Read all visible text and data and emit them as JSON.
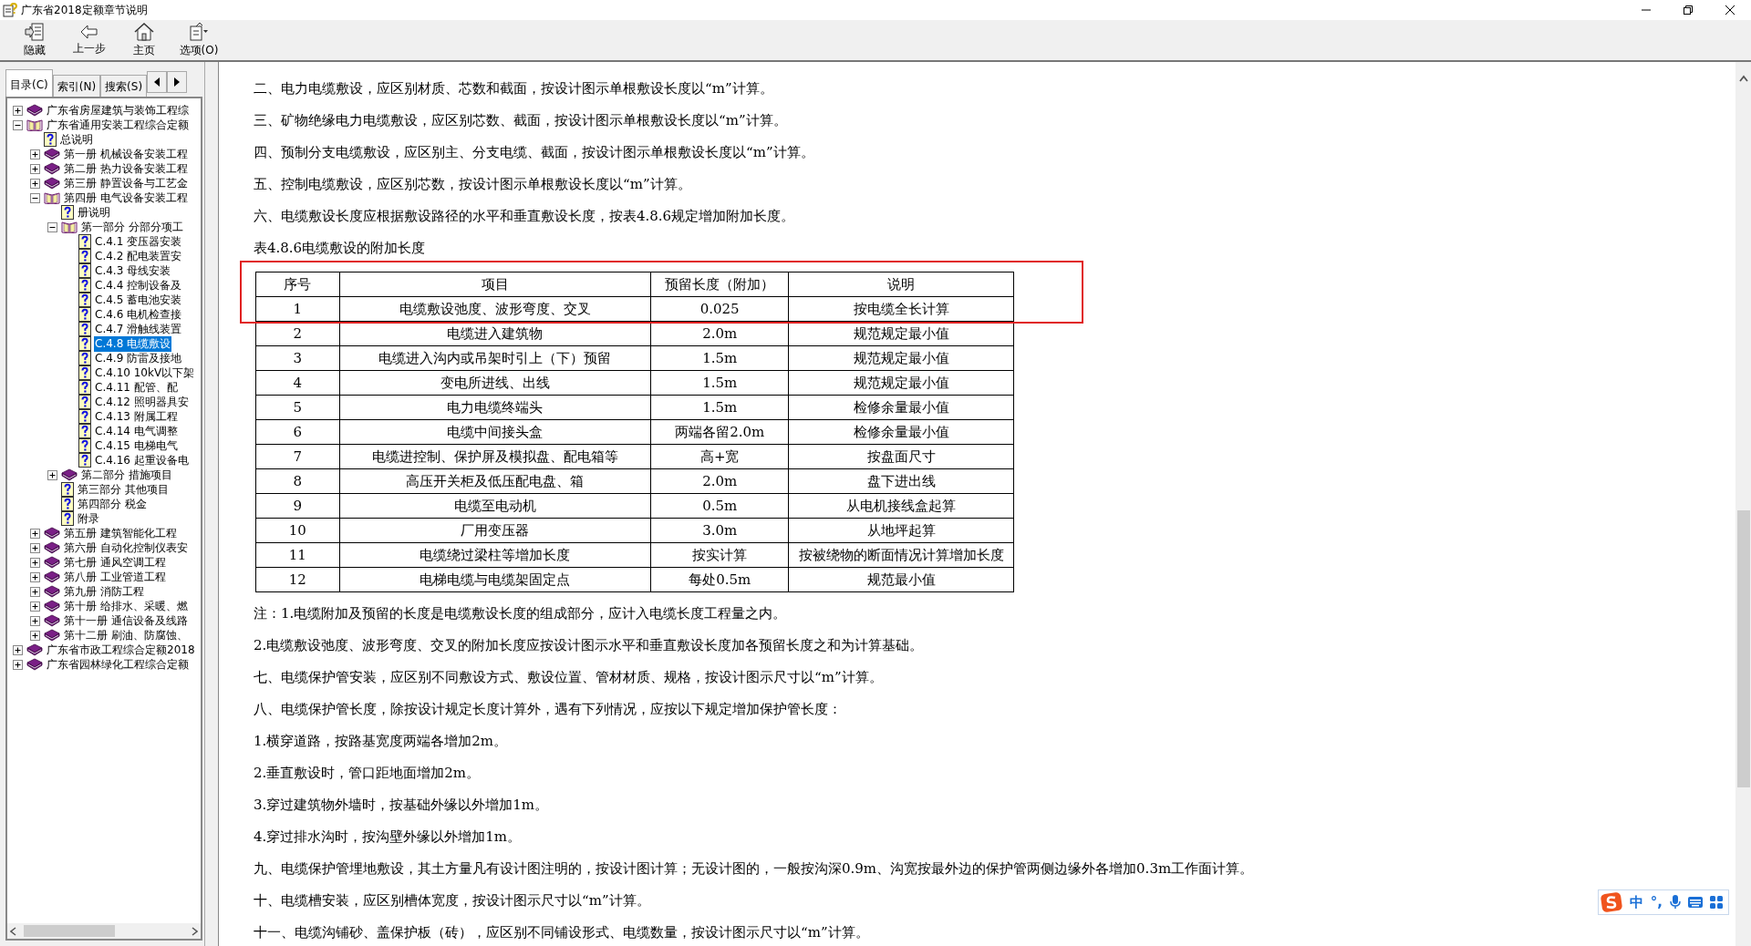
{
  "window": {
    "title": "广东省2018定额章节说明"
  },
  "toolbar": [
    {
      "kind": "hide",
      "label": "隐藏"
    },
    {
      "kind": "back",
      "label": "上一步"
    },
    {
      "kind": "home",
      "label": "主页"
    },
    {
      "kind": "options",
      "label": "选项(O)"
    }
  ],
  "tabs": [
    {
      "label": "目录(C)",
      "selected": true
    },
    {
      "label": "索引(N)",
      "selected": false
    },
    {
      "label": "搜索(S)",
      "selected": false
    }
  ],
  "tree": [
    {
      "label": "广东省房屋建筑与装饰工程综",
      "kind": "book",
      "expanded": false,
      "selected": false
    },
    {
      "label": "广东省通用安装工程综合定额",
      "kind": "book",
      "expanded": true,
      "selected": false,
      "children": [
        {
          "label": "总说明",
          "kind": "page",
          "selected": false
        },
        {
          "label": "第一册 机械设备安装工程",
          "kind": "book",
          "expanded": false,
          "selected": false
        },
        {
          "label": "第二册 热力设备安装工程",
          "kind": "book",
          "expanded": false,
          "selected": false
        },
        {
          "label": "第三册 静置设备与工艺金",
          "kind": "book",
          "expanded": false,
          "selected": false
        },
        {
          "label": "第四册 电气设备安装工程",
          "kind": "book",
          "expanded": true,
          "selected": false,
          "children": [
            {
              "label": "册说明",
              "kind": "page",
              "selected": false
            },
            {
              "label": "第一部分 分部分项工",
              "kind": "book",
              "expanded": true,
              "selected": false,
              "children": [
                {
                  "label": "C.4.1 变压器安装",
                  "kind": "page",
                  "selected": false
                },
                {
                  "label": "C.4.2 配电装置安",
                  "kind": "page",
                  "selected": false
                },
                {
                  "label": "C.4.3 母线安装",
                  "kind": "page",
                  "selected": false
                },
                {
                  "label": "C.4.4 控制设备及",
                  "kind": "page",
                  "selected": false
                },
                {
                  "label": "C.4.5 蓄电池安装",
                  "kind": "page",
                  "selected": false
                },
                {
                  "label": "C.4.6 电机检查接",
                  "kind": "page",
                  "selected": false
                },
                {
                  "label": "C.4.7 滑触线装置",
                  "kind": "page",
                  "selected": false
                },
                {
                  "label": "C.4.8 电缆敷设",
                  "kind": "page",
                  "selected": true
                },
                {
                  "label": "C.4.9 防雷及接地",
                  "kind": "page",
                  "selected": false
                },
                {
                  "label": "C.4.10 10kV以下架",
                  "kind": "page",
                  "selected": false
                },
                {
                  "label": "C.4.11 配管、配",
                  "kind": "page",
                  "selected": false
                },
                {
                  "label": "C.4.12 照明器具安",
                  "kind": "page",
                  "selected": false
                },
                {
                  "label": "C.4.13 附属工程",
                  "kind": "page",
                  "selected": false
                },
                {
                  "label": "C.4.14 电气调整",
                  "kind": "page",
                  "selected": false
                },
                {
                  "label": "C.4.15 电梯电气",
                  "kind": "page",
                  "selected": false
                },
                {
                  "label": "C.4.16 起重设备电",
                  "kind": "page",
                  "selected": false
                }
              ]
            },
            {
              "label": "第二部分 措施项目",
              "kind": "book",
              "expanded": false,
              "selected": false
            },
            {
              "label": "第三部分 其他项目",
              "kind": "page",
              "selected": false
            },
            {
              "label": "第四部分 税金",
              "kind": "page",
              "selected": false
            },
            {
              "label": "附录",
              "kind": "page",
              "selected": false
            }
          ]
        },
        {
          "label": "第五册 建筑智能化工程",
          "kind": "book",
          "expanded": false,
          "selected": false
        },
        {
          "label": "第六册 自动化控制仪表安",
          "kind": "book",
          "expanded": false,
          "selected": false
        },
        {
          "label": "第七册 通风空调工程",
          "kind": "book",
          "expanded": false,
          "selected": false
        },
        {
          "label": "第八册 工业管道工程",
          "kind": "book",
          "expanded": false,
          "selected": false
        },
        {
          "label": "第九册 消防工程",
          "kind": "book",
          "expanded": false,
          "selected": false
        },
        {
          "label": "第十册 给排水、采暖、燃",
          "kind": "book",
          "expanded": false,
          "selected": false
        },
        {
          "label": "第十一册 通信设备及线路",
          "kind": "book",
          "expanded": false,
          "selected": false
        },
        {
          "label": "第十二册 刷油、防腐蚀、",
          "kind": "book",
          "expanded": false,
          "selected": false
        }
      ]
    },
    {
      "label": "广东省市政工程综合定额2018",
      "kind": "book",
      "expanded": false,
      "selected": false
    },
    {
      "label": "广东省园林绿化工程综合定额",
      "kind": "book",
      "expanded": false,
      "selected": false
    }
  ],
  "content_before": [
    "二、电力电缆敷设，应区别材质、芯数和截面，按设计图示单根敷设长度以“m”计算。",
    "三、矿物绝缘电力电缆敷设，应区别芯数、截面，按设计图示单根敷设长度以“m”计算。",
    "四、预制分支电缆敷设，应区别主、分支电缆、截面，按设计图示单根敷设长度以“m”计算。",
    "五、控制电缆敷设，应区别芯数，按设计图示单根敷设长度以“m”计算。",
    "六、电缆敷设长度应根据敷设路径的水平和垂直敷设长度，按表4.8.6规定增加附加长度。",
    "表4.8.6电缆敷设的附加长度"
  ],
  "table": {
    "columns": [
      "序号",
      "项目",
      "预留长度（附加）",
      "说明"
    ],
    "rows": [
      [
        "1",
        "电缆敷设弛度、波形弯度、交叉",
        "0.025",
        "按电缆全长计算"
      ],
      [
        "2",
        "电缆进入建筑物",
        "2.0m",
        "规范规定最小值"
      ],
      [
        "3",
        "电缆进入沟内或吊架时引上（下）预留",
        "1.5m",
        "规范规定最小值"
      ],
      [
        "4",
        "变电所进线、出线",
        "1.5m",
        "规范规定最小值"
      ],
      [
        "5",
        "电力电缆终端头",
        "1.5m",
        "检修余量最小值"
      ],
      [
        "6",
        "电缆中间接头盒",
        "两端各留2.0m",
        "检修余量最小值"
      ],
      [
        "7",
        "电缆进控制、保护屏及模拟盘、配电箱等",
        "高+宽",
        "按盘面尺寸"
      ],
      [
        "8",
        "高压开关柜及低压配电盘、箱",
        "2.0m",
        "盘下进出线"
      ],
      [
        "9",
        "电缆至电动机",
        "0.5m",
        "从电机接线盒起算"
      ],
      [
        "10",
        "厂用变压器",
        "3.0m",
        "从地坪起算"
      ],
      [
        "11",
        "电缆绕过梁柱等增加长度",
        "按实计算",
        "按被绕物的断面情况计算增加长度"
      ],
      [
        "12",
        "电梯电缆与电缆架固定点",
        "每处0.5m",
        "规范最小值"
      ]
    ]
  },
  "content_after": [
    "注：1.电缆附加及预留的长度是电缆敷设长度的组成部分，应计入电缆长度工程量之内。",
    "2.电缆敷设弛度、波形弯度、交叉的附加长度应按设计图示水平和垂直敷设长度加各预留长度之和为计算基础。",
    "七、电缆保护管安装，应区别不同敷设方式、敷设位置、管材材质、规格，按设计图示尺寸以“m”计算。",
    "八、电缆保护管长度，除按设计规定长度计算外，遇有下列情况，应按以下规定增加保护管长度：",
    "1.横穿道路，按路基宽度两端各增加2m。",
    "2.垂直敷设时，管口距地面增加2m。",
    "3.穿过建筑物外墙时，按基础外缘以外增加1m。",
    "4.穿过排水沟时，按沟壁外缘以外增加1m。",
    "九、电缆保护管埋地敷设，其土方量凡有设计图注明的，按设计图计算；无设计图的，一般按沟深0.9m、沟宽按最外边的保护管两侧边缘外各增加0.3m工作面计算。",
    "十、电缆槽安装，应区别槽体宽度，按设计图示尺寸以“m”计算。",
    "十一、电缆沟铺砂、盖保护板（砖），应区别不同铺设形式、电缆数量，按设计图示尺寸以“m”计算。"
  ],
  "ime_bar": {
    "mode": "中",
    "punct": "°,"
  }
}
